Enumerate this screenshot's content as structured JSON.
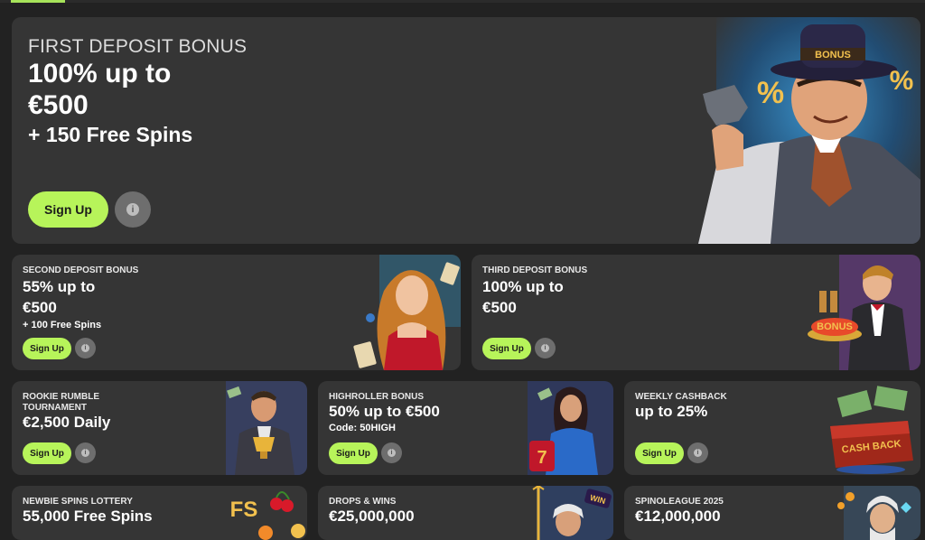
{
  "hero": {
    "label": "FIRST DEPOSIT BONUS",
    "line1": "100% up to",
    "line2": "€500",
    "line3": "+ 150 Free Spins",
    "button": "Sign Up",
    "info": "i",
    "hat_text": "BONUS",
    "badge_left": "%",
    "badge_right": "%"
  },
  "second": {
    "label": "SECOND DEPOSIT BONUS",
    "line1": "55% up to",
    "line2": "€500",
    "line3": "+ 100 Free Spins",
    "button": "Sign Up",
    "info": "i"
  },
  "third": {
    "label": "THIRD DEPOSIT BONUS",
    "line1": "100% up to",
    "line2": "€500",
    "button": "Sign Up",
    "info": "i",
    "tray_text": "BONUS"
  },
  "rookie": {
    "label_1": "ROOKIE RUMBLE",
    "label_2": "TOURNAMENT",
    "line1": "€2,500 Daily",
    "button": "Sign Up",
    "info": "i"
  },
  "highroller": {
    "label": "HIGHROLLER BONUS",
    "line1": "50% up to €500",
    "line2": "Code: 50HIGH",
    "button": "Sign Up",
    "info": "i",
    "slot_text": "7"
  },
  "cashback": {
    "label": "WEEKLY CASHBACK",
    "line1": "up to 25%",
    "button": "Sign Up",
    "info": "i",
    "case_text": "CASH BACK"
  },
  "lottery": {
    "label": "NEWBIE SPINS LOTTERY",
    "line1": "55,000 Free Spins",
    "fs_text": "FS"
  },
  "drops": {
    "label": "DROPS & WINS",
    "line1": "€25,000,000",
    "win_text": "WIN"
  },
  "spinoleague": {
    "label": "SPINOLEAGUE 2025",
    "line1": "€12,000,000"
  },
  "colors": {
    "accent": "#b7f45a",
    "card": "#353535",
    "page": "#222222"
  }
}
